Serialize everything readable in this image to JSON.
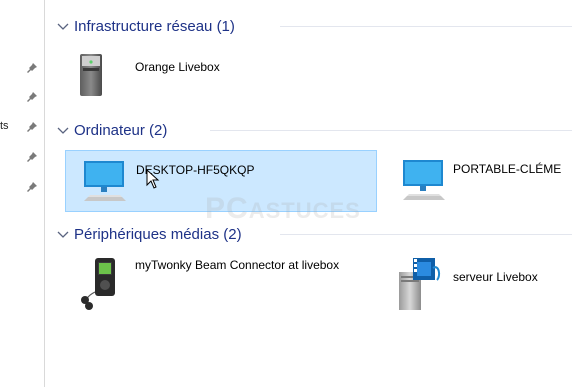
{
  "left_pane": {
    "cut_text": "ts",
    "pin_count": 5
  },
  "groups": [
    {
      "title": "Infrastructure réseau (1)",
      "items": [
        {
          "label": "Orange Livebox",
          "icon": "network-infrastructure-icon"
        }
      ]
    },
    {
      "title": "Ordinateur (2)",
      "items": [
        {
          "label": "DESKTOP-HF5QKQP",
          "icon": "computer-icon",
          "selected": true
        },
        {
          "label": "PORTABLE-CLÉME",
          "icon": "computer-icon"
        }
      ]
    },
    {
      "title": "Périphériques médias (2)",
      "items": [
        {
          "label": "myTwonky Beam Connector at livebox",
          "icon": "media-player-icon"
        },
        {
          "label": "serveur Livebox",
          "icon": "media-server-icon"
        }
      ]
    }
  ],
  "watermark": {
    "text_main": "PC",
    "text_rest": "ASTUCES"
  },
  "colors": {
    "header_text": "#1e3287",
    "selection_bg": "#cce8ff",
    "selection_border": "#99d1ff"
  }
}
